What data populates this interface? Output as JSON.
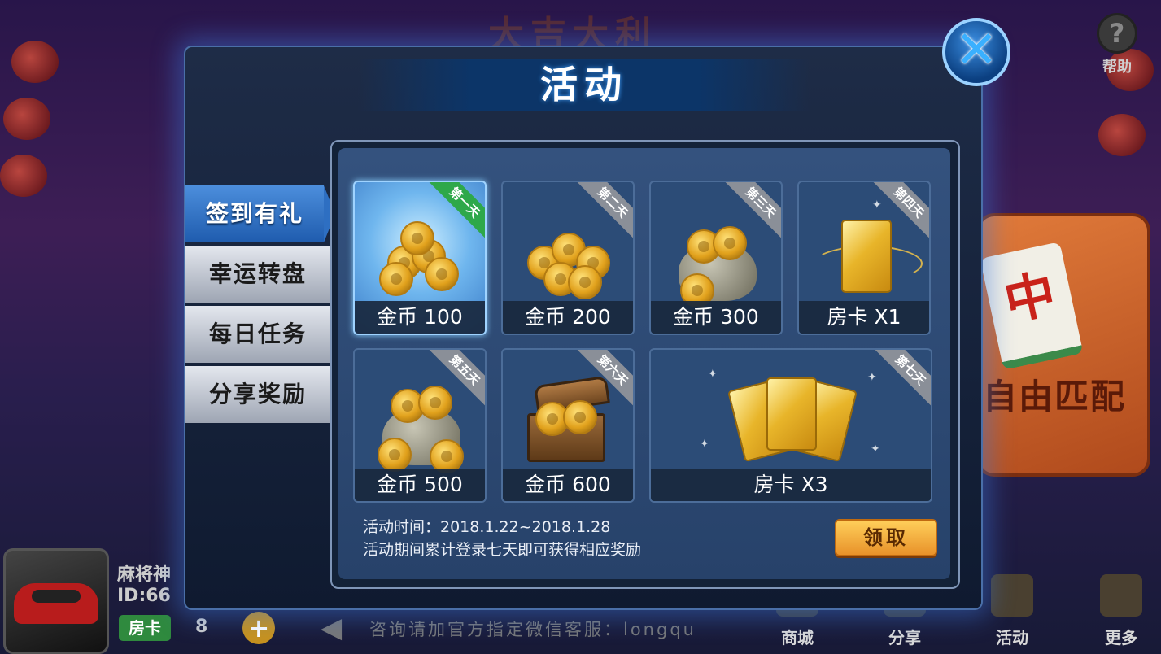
{
  "background": {
    "title": "大吉大利",
    "help_label": "帮助",
    "match_label": "自由匹配",
    "player": {
      "name": "麻将神",
      "id": "ID:66",
      "card_label": "房卡",
      "card_count": "8"
    },
    "notice": "咨询请加官方指定微信客服：longqu",
    "nav": [
      {
        "label": "商城",
        "icon": "shop-icon"
      },
      {
        "label": "分享",
        "icon": "share-icon"
      },
      {
        "label": "活动",
        "icon": "gift-icon"
      },
      {
        "label": "更多",
        "icon": "more-icon"
      }
    ]
  },
  "modal": {
    "title": "活动",
    "close_icon": "close-icon",
    "tabs": [
      {
        "label": "签到有礼",
        "active": true
      },
      {
        "label": "幸运转盘",
        "active": false
      },
      {
        "label": "每日任务",
        "active": false
      },
      {
        "label": "分享奖励",
        "active": false
      }
    ],
    "rewards": [
      {
        "day": "第一天",
        "label": "金币 100",
        "icon": "coin-stack-icon",
        "claimable": true
      },
      {
        "day": "第二天",
        "label": "金币 200",
        "icon": "coin-stack-icon",
        "claimable": false
      },
      {
        "day": "第三天",
        "label": "金币 300",
        "icon": "coin-bag-icon",
        "claimable": false
      },
      {
        "day": "第四天",
        "label": "房卡 X1",
        "icon": "gold-card-icon",
        "claimable": false
      },
      {
        "day": "第五天",
        "label": "金币 500",
        "icon": "coin-bag-icon",
        "claimable": false
      },
      {
        "day": "第六天",
        "label": "金币 600",
        "icon": "treasure-chest-icon",
        "claimable": false
      },
      {
        "day": "第七天",
        "label": "房卡 X3",
        "icon": "gold-cards-icon",
        "claimable": false
      }
    ],
    "info_time": "活动时间：2018.1.22~2018.1.28",
    "info_desc": "活动期间累计登录七天即可获得相应奖励",
    "claim_label": "领取"
  },
  "colors": {
    "accent_blue": "#2e6fc2",
    "claim_orange": "#e8922a",
    "ribbon_green": "#2ea84a",
    "ribbon_gray": "#8a8f98"
  }
}
